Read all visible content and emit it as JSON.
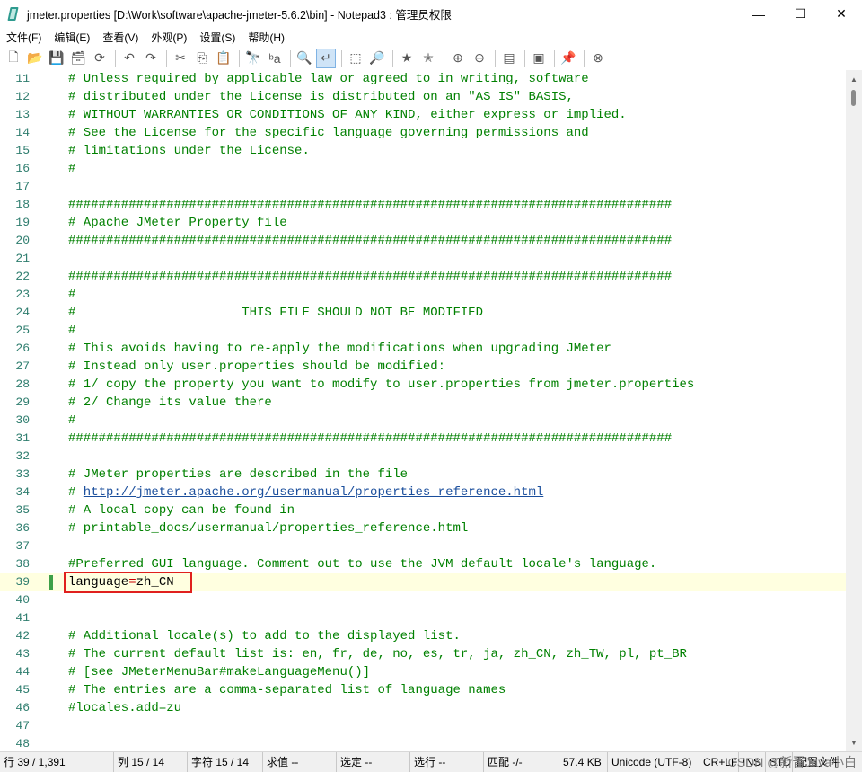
{
  "window": {
    "title": "jmeter.properties [D:\\Work\\software\\apache-jmeter-5.6.2\\bin] - Notepad3 : 管理员权限",
    "minimize": "—",
    "maximize": "☐",
    "close": "✕"
  },
  "menu": [
    "文件(F)",
    "编辑(E)",
    "查看(V)",
    "外观(P)",
    "设置(S)",
    "帮助(H)"
  ],
  "toolbar": [
    {
      "name": "new-file",
      "glyph": "🗋"
    },
    {
      "name": "open-folder",
      "glyph": "📂"
    },
    {
      "name": "save",
      "glyph": "💾"
    },
    {
      "name": "save-as",
      "glyph": "🗃"
    },
    {
      "name": "reload",
      "glyph": "⟳"
    },
    {
      "sep": true
    },
    {
      "name": "undo",
      "glyph": "↶"
    },
    {
      "name": "redo",
      "glyph": "↷"
    },
    {
      "sep": true
    },
    {
      "name": "cut",
      "glyph": "✂"
    },
    {
      "name": "copy",
      "glyph": "⎘"
    },
    {
      "name": "paste",
      "glyph": "📋"
    },
    {
      "sep": true
    },
    {
      "name": "find",
      "glyph": "🔭"
    },
    {
      "name": "replace",
      "glyph": "ᵇa"
    },
    {
      "sep": true
    },
    {
      "name": "find-in-files",
      "glyph": "🔍"
    },
    {
      "name": "word-wrap",
      "glyph": "↵",
      "active": true
    },
    {
      "sep": true
    },
    {
      "name": "select-all",
      "glyph": "⬚"
    },
    {
      "name": "find-next",
      "glyph": "🔎"
    },
    {
      "sep": true
    },
    {
      "name": "favorites",
      "glyph": "★"
    },
    {
      "name": "add-favorite",
      "glyph": "✭"
    },
    {
      "sep": true
    },
    {
      "name": "zoom-in",
      "glyph": "⊕"
    },
    {
      "name": "zoom-out",
      "glyph": "⊖"
    },
    {
      "sep": true
    },
    {
      "name": "scheme",
      "glyph": "▤"
    },
    {
      "sep": true
    },
    {
      "name": "customize",
      "glyph": "▣"
    },
    {
      "sep": true
    },
    {
      "name": "pin",
      "glyph": "📌"
    },
    {
      "sep": true
    },
    {
      "name": "exit",
      "glyph": "⊗"
    }
  ],
  "editor": {
    "current_line": 39,
    "lines": [
      [
        11,
        "# Unless required by applicable law or agreed to in writing, software"
      ],
      [
        12,
        "# distributed under the License is distributed on an \"AS IS\" BASIS,"
      ],
      [
        13,
        "# WITHOUT WARRANTIES OR CONDITIONS OF ANY KIND, either express or implied."
      ],
      [
        14,
        "# See the License for the specific language governing permissions and"
      ],
      [
        15,
        "# limitations under the License."
      ],
      [
        16,
        "#"
      ],
      [
        17,
        ""
      ],
      [
        18,
        "################################################################################"
      ],
      [
        19,
        "# Apache JMeter Property file"
      ],
      [
        20,
        "################################################################################"
      ],
      [
        21,
        ""
      ],
      [
        22,
        "################################################################################"
      ],
      [
        23,
        "#"
      ],
      [
        24,
        "#                      THIS FILE SHOULD NOT BE MODIFIED"
      ],
      [
        25,
        "#"
      ],
      [
        26,
        "# This avoids having to re-apply the modifications when upgrading JMeter"
      ],
      [
        27,
        "# Instead only user.properties should be modified:"
      ],
      [
        28,
        "# 1/ copy the property you want to modify to user.properties from jmeter.properties"
      ],
      [
        29,
        "# 2/ Change its value there"
      ],
      [
        30,
        "#"
      ],
      [
        31,
        "################################################################################"
      ],
      [
        32,
        ""
      ],
      [
        33,
        "# JMeter properties are described in the file"
      ],
      [
        34,
        "# http://jmeter.apache.org/usermanual/properties_reference.html"
      ],
      [
        35,
        "# A local copy can be found in"
      ],
      [
        36,
        "# printable_docs/usermanual/properties_reference.html"
      ],
      [
        37,
        ""
      ],
      [
        38,
        "#Preferred GUI language. Comment out to use the JVM default locale's language."
      ],
      [
        39,
        "language=zh_CN"
      ],
      [
        40,
        ""
      ],
      [
        41,
        ""
      ],
      [
        42,
        "# Additional locale(s) to add to the displayed list."
      ],
      [
        43,
        "# The current default list is: en, fr, de, no, es, tr, ja, zh_CN, zh_TW, pl, pt_BR"
      ],
      [
        44,
        "# [see JMeterMenuBar#makeLanguageMenu()]"
      ],
      [
        45,
        "# The entries are a comma-separated list of language names"
      ],
      [
        46,
        "#locales.add=zu"
      ],
      [
        47,
        ""
      ],
      [
        48,
        ""
      ]
    ],
    "link_prefix": "# ",
    "link_text": "http://jmeter.apache.org/usermanual/properties_reference.html",
    "key": "language",
    "equals": "=",
    "value": "zh_CN"
  },
  "status": {
    "line": "行  39 / 1,391",
    "col": "列  15 / 14",
    "char": "字符  15 / 14",
    "eval": "求值  --",
    "sel": "选定  --",
    "selline": "选行  --",
    "match": "匹配  -/-",
    "size": "57.4 KB",
    "encoding": "Unicode (UTF-8)",
    "eol": "CR+LF",
    "ovr": "INS",
    "mode": "STD",
    "config": "配置文件",
    "watermark": "CSDN @新晋Java小白"
  },
  "colors": {
    "comment": "#008000",
    "link": "#1a4e9c",
    "current_line_bg": "#ffffe0",
    "highlight_box": "#e0201e",
    "change_marker": "#3ea048",
    "line_number": "#2e7d6e"
  }
}
